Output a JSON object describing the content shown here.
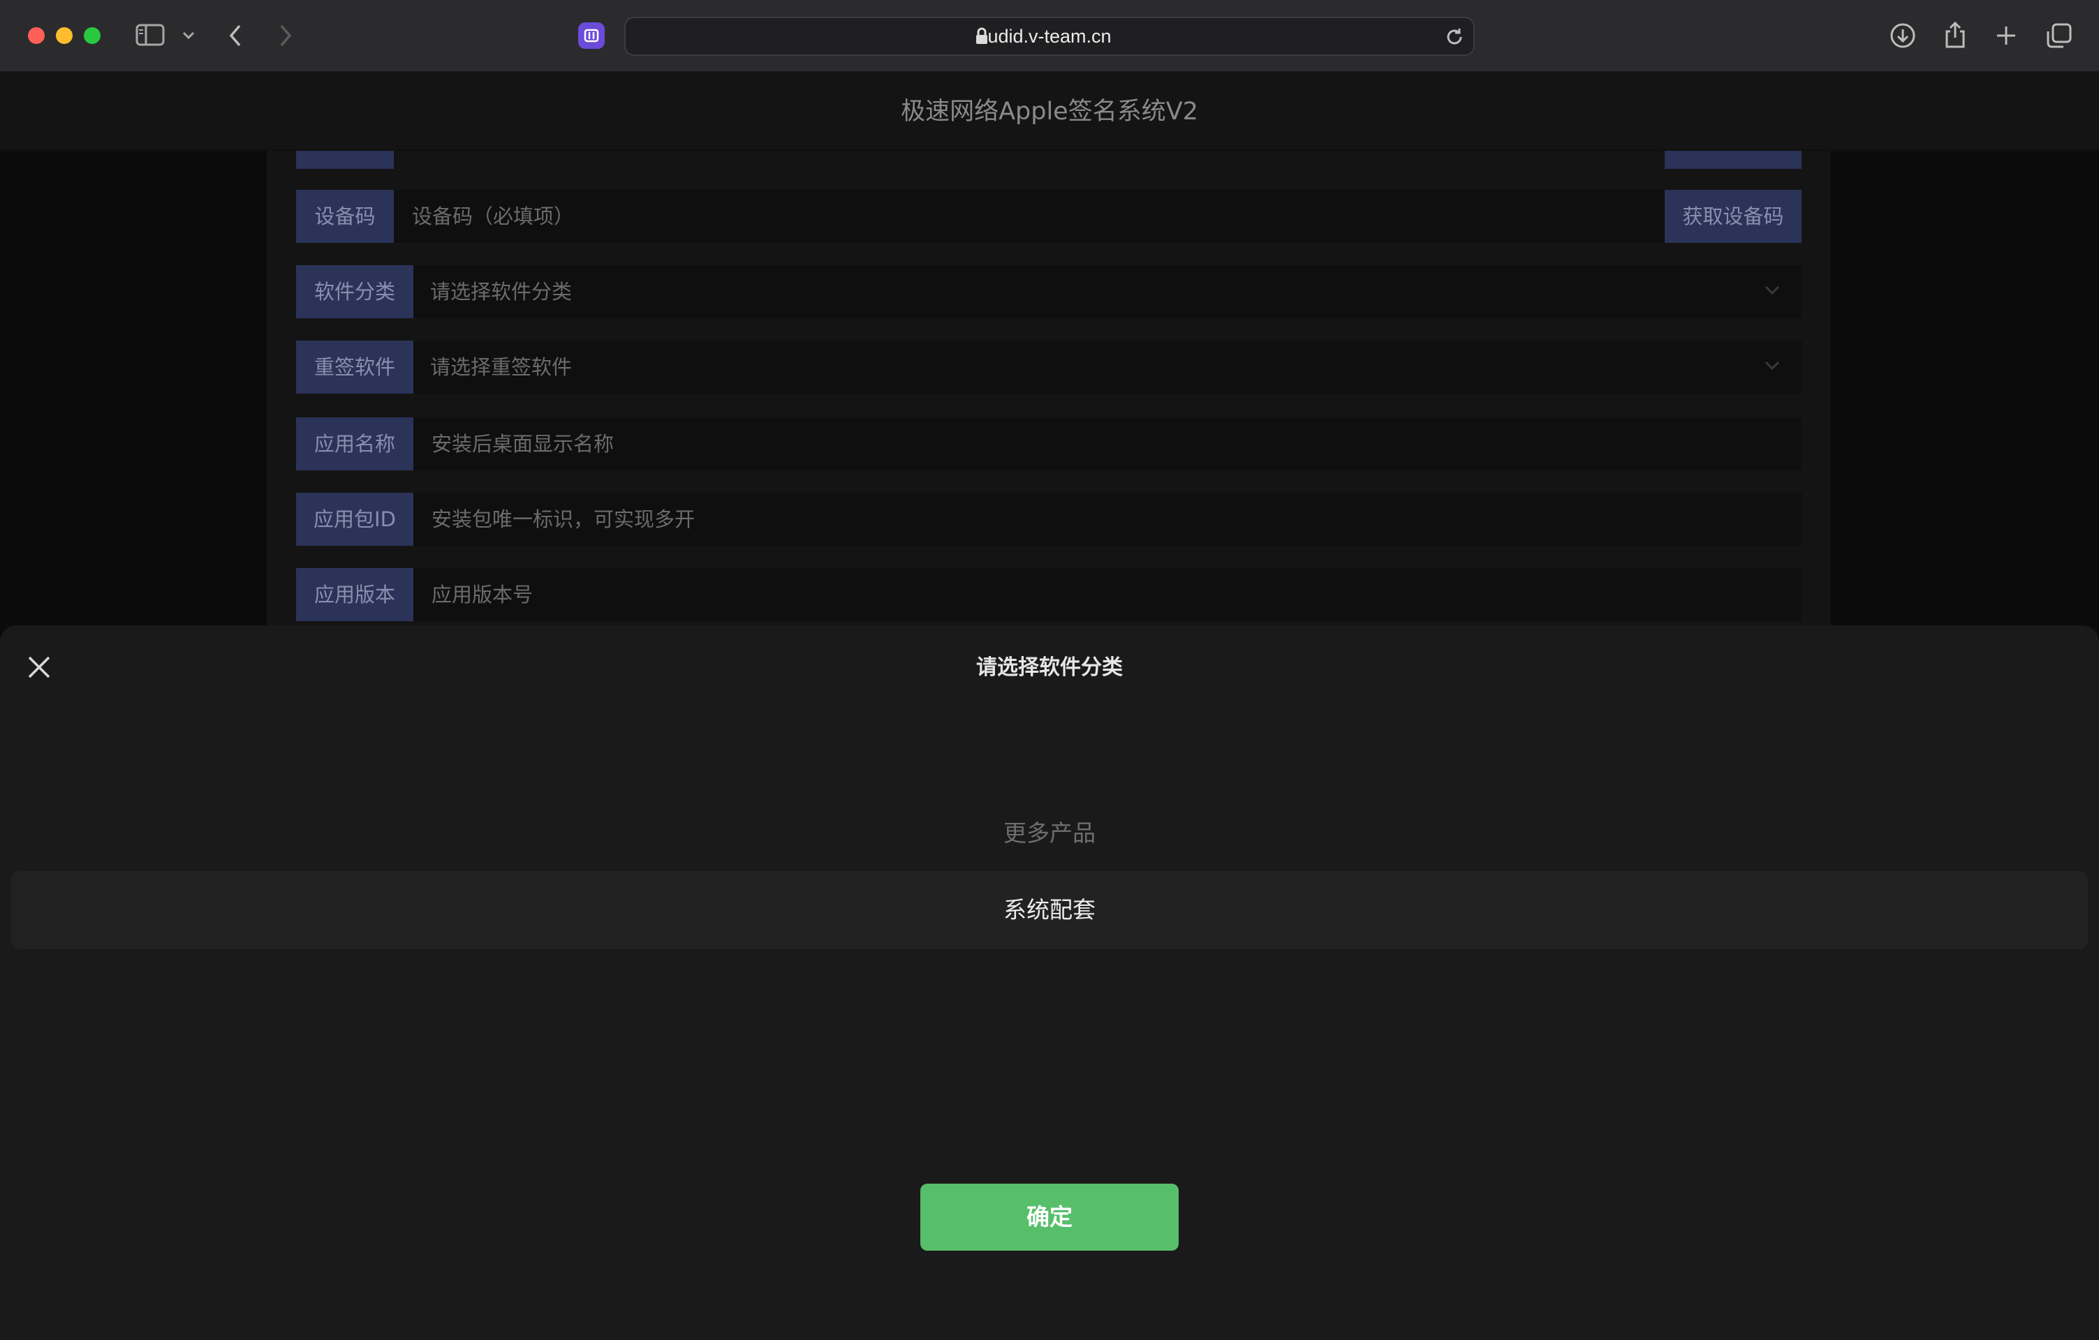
{
  "browser": {
    "url": "udid.v-team.cn"
  },
  "page": {
    "title": "极速网络Apple签名系统V2",
    "rows": [
      {
        "label": "设备码",
        "placeholder": "设备码（必填项）",
        "button": "获取设备码"
      },
      {
        "label": "软件分类",
        "placeholder": "请选择软件分类"
      },
      {
        "label": "重签软件",
        "placeholder": "请选择重签软件"
      },
      {
        "label": "应用名称",
        "placeholder": "安装后桌面显示名称"
      },
      {
        "label": "应用包ID",
        "placeholder": "安装包唯一标识，可实现多开"
      },
      {
        "label": "应用版本",
        "placeholder": "应用版本号"
      }
    ]
  },
  "picker": {
    "title": "请选择软件分类",
    "options": [
      "更多产品",
      "系统配套"
    ],
    "selected": "系统配套",
    "confirm_label": "确定"
  },
  "colors": {
    "accent_label_bg": "#2c3358",
    "confirm_green": "#57be6a"
  }
}
